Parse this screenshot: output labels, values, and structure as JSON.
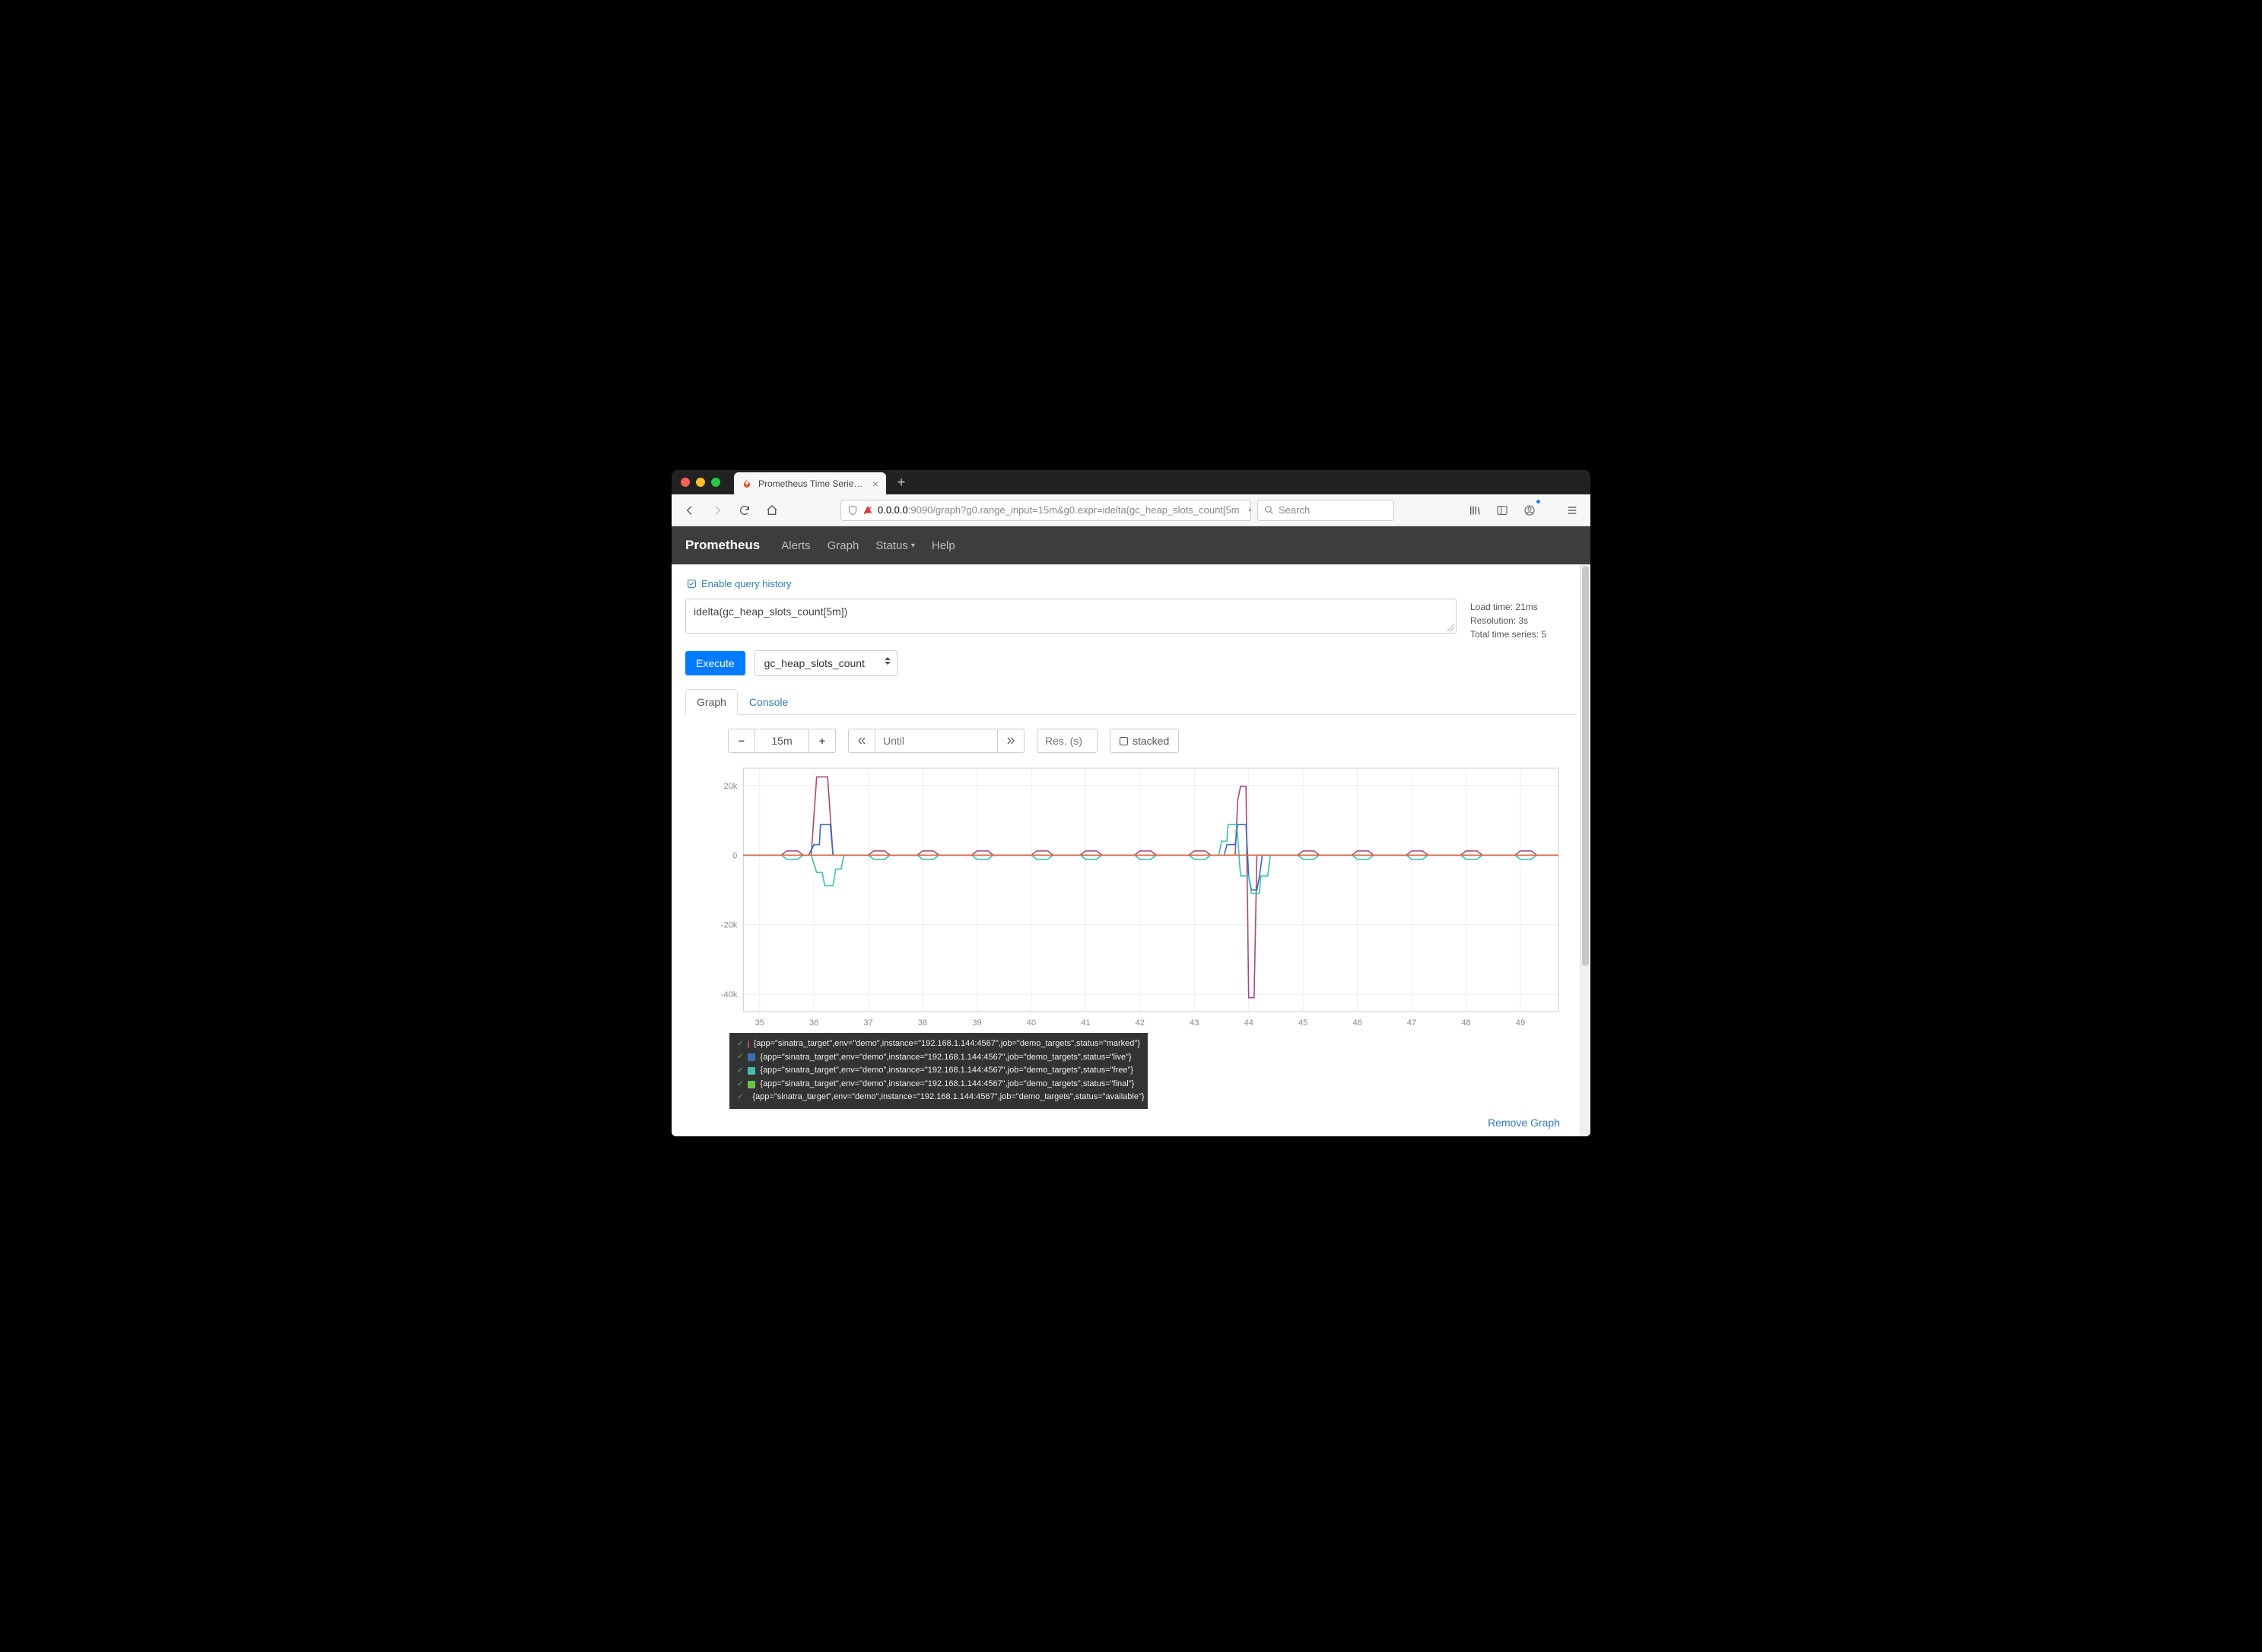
{
  "browser": {
    "tab_title": "Prometheus Time Series Collec",
    "url_host": "0.0.0.0",
    "url_rest": ":9090/graph?g0.range_input=15m&g0.expr=idelta(gc_heap_slots_count[5m",
    "search_placeholder": "Search"
  },
  "nav": {
    "brand": "Prometheus",
    "alerts": "Alerts",
    "graph": "Graph",
    "status": "Status",
    "help": "Help"
  },
  "query": {
    "history_label": "Enable query history",
    "expression": "idelta(gc_heap_slots_count[5m])",
    "execute": "Execute",
    "metric": "gc_heap_slots_count",
    "stats_load": "Load time: 21ms",
    "stats_res": "Resolution: 3s",
    "stats_series": "Total time series: 5"
  },
  "tabs": {
    "graph": "Graph",
    "console": "Console"
  },
  "controls": {
    "range": "15m",
    "until_placeholder": "Until",
    "res_placeholder": "Res. (s)",
    "stacked": "stacked"
  },
  "legend": {
    "colors": [
      "#a94a7c",
      "#3b6db3",
      "#3ec0b0",
      "#6cc24a",
      "#e06943"
    ],
    "items": [
      "{app=\"sinatra_target\",env=\"demo\",instance=\"192.168.1.144:4567\",job=\"demo_targets\",status=\"marked\"}",
      "{app=\"sinatra_target\",env=\"demo\",instance=\"192.168.1.144:4567\",job=\"demo_targets\",status=\"live\"}",
      "{app=\"sinatra_target\",env=\"demo\",instance=\"192.168.1.144:4567\",job=\"demo_targets\",status=\"free\"}",
      "{app=\"sinatra_target\",env=\"demo\",instance=\"192.168.1.144:4567\",job=\"demo_targets\",status=\"final\"}",
      "{app=\"sinatra_target\",env=\"demo\",instance=\"192.168.1.144:4567\",job=\"demo_targets\",status=\"available\"}"
    ]
  },
  "footer": {
    "remove": "Remove Graph"
  },
  "chart_data": {
    "type": "line",
    "xlabel": "",
    "ylabel": "",
    "x_ticks": [
      35,
      36,
      37,
      38,
      39,
      40,
      41,
      42,
      43,
      44,
      45,
      46,
      47,
      48,
      49
    ],
    "y_ticks": [
      -40000,
      -20000,
      0,
      20000
    ],
    "y_tick_labels": [
      "-40k",
      "-20k",
      "0",
      "20k"
    ],
    "ylim": [
      -45000,
      25000
    ],
    "xlim": [
      34.7,
      49.7
    ],
    "series": [
      {
        "name": "marked",
        "color": "#a94a7c",
        "values": [
          [
            34.7,
            0
          ],
          [
            35.4,
            0
          ],
          [
            35.5,
            1200
          ],
          [
            35.7,
            1200
          ],
          [
            35.8,
            0
          ],
          [
            35.95,
            0
          ],
          [
            36.05,
            22500
          ],
          [
            36.25,
            22500
          ],
          [
            36.35,
            0
          ],
          [
            37.0,
            0
          ],
          [
            37.1,
            1200
          ],
          [
            37.3,
            1200
          ],
          [
            37.4,
            0
          ],
          [
            37.9,
            0
          ],
          [
            38.0,
            1200
          ],
          [
            38.2,
            1200
          ],
          [
            38.3,
            0
          ],
          [
            38.9,
            0
          ],
          [
            39.0,
            1200
          ],
          [
            39.2,
            1200
          ],
          [
            39.3,
            0
          ],
          [
            40.0,
            0
          ],
          [
            40.1,
            1200
          ],
          [
            40.3,
            1200
          ],
          [
            40.4,
            0
          ],
          [
            40.9,
            0
          ],
          [
            41.0,
            1200
          ],
          [
            41.2,
            1200
          ],
          [
            41.3,
            0
          ],
          [
            41.9,
            0
          ],
          [
            42.0,
            1200
          ],
          [
            42.2,
            1200
          ],
          [
            42.3,
            0
          ],
          [
            42.9,
            0
          ],
          [
            43.0,
            1200
          ],
          [
            43.2,
            1200
          ],
          [
            43.3,
            0
          ],
          [
            43.75,
            0
          ],
          [
            43.8,
            16000
          ],
          [
            43.85,
            19800
          ],
          [
            43.95,
            19800
          ],
          [
            44.0,
            -41000
          ],
          [
            44.1,
            -41000
          ],
          [
            44.15,
            0
          ],
          [
            44.9,
            0
          ],
          [
            45.0,
            1200
          ],
          [
            45.2,
            1200
          ],
          [
            45.3,
            0
          ],
          [
            45.9,
            0
          ],
          [
            46.0,
            1200
          ],
          [
            46.2,
            1200
          ],
          [
            46.3,
            0
          ],
          [
            46.9,
            0
          ],
          [
            47.0,
            1200
          ],
          [
            47.2,
            1200
          ],
          [
            47.3,
            0
          ],
          [
            47.9,
            0
          ],
          [
            48.0,
            1200
          ],
          [
            48.2,
            1200
          ],
          [
            48.3,
            0
          ],
          [
            48.9,
            0
          ],
          [
            49.0,
            1200
          ],
          [
            49.2,
            1200
          ],
          [
            49.3,
            0
          ],
          [
            49.7,
            0
          ]
        ]
      },
      {
        "name": "live",
        "color": "#3b6db3",
        "values": [
          [
            34.7,
            0
          ],
          [
            35.9,
            0
          ],
          [
            36.0,
            3000
          ],
          [
            36.1,
            3000
          ],
          [
            36.12,
            8800
          ],
          [
            36.3,
            8800
          ],
          [
            36.35,
            0
          ],
          [
            43.55,
            0
          ],
          [
            43.6,
            3000
          ],
          [
            43.75,
            3000
          ],
          [
            43.8,
            8800
          ],
          [
            43.95,
            8800
          ],
          [
            44.0,
            -6000
          ],
          [
            44.05,
            -10000
          ],
          [
            44.15,
            -10000
          ],
          [
            44.2,
            -6000
          ],
          [
            44.25,
            0
          ],
          [
            49.7,
            0
          ]
        ]
      },
      {
        "name": "free",
        "color": "#3ec0b0",
        "values": [
          [
            34.7,
            0
          ],
          [
            35.4,
            0
          ],
          [
            35.5,
            -1200
          ],
          [
            35.7,
            -1200
          ],
          [
            35.8,
            0
          ],
          [
            35.95,
            0
          ],
          [
            36.05,
            -5000
          ],
          [
            36.15,
            -5000
          ],
          [
            36.2,
            -8800
          ],
          [
            36.35,
            -8800
          ],
          [
            36.4,
            -4000
          ],
          [
            36.5,
            -4000
          ],
          [
            36.55,
            0
          ],
          [
            37.0,
            0
          ],
          [
            37.1,
            -1200
          ],
          [
            37.3,
            -1200
          ],
          [
            37.4,
            0
          ],
          [
            37.9,
            0
          ],
          [
            38.0,
            -1200
          ],
          [
            38.2,
            -1200
          ],
          [
            38.3,
            0
          ],
          [
            38.9,
            0
          ],
          [
            39.0,
            -1200
          ],
          [
            39.2,
            -1200
          ],
          [
            39.3,
            0
          ],
          [
            40.0,
            0
          ],
          [
            40.1,
            -1200
          ],
          [
            40.3,
            -1200
          ],
          [
            40.4,
            0
          ],
          [
            40.9,
            0
          ],
          [
            41.0,
            -1200
          ],
          [
            41.2,
            -1200
          ],
          [
            41.3,
            0
          ],
          [
            41.9,
            0
          ],
          [
            42.0,
            -1200
          ],
          [
            42.2,
            -1200
          ],
          [
            42.3,
            0
          ],
          [
            42.9,
            0
          ],
          [
            43.0,
            -1200
          ],
          [
            43.2,
            -1200
          ],
          [
            43.3,
            0
          ],
          [
            43.45,
            0
          ],
          [
            43.5,
            4000
          ],
          [
            43.6,
            4000
          ],
          [
            43.62,
            8800
          ],
          [
            43.78,
            8800
          ],
          [
            43.85,
            -6000
          ],
          [
            44.0,
            -6000
          ],
          [
            44.05,
            -11000
          ],
          [
            44.2,
            -11000
          ],
          [
            44.22,
            -6000
          ],
          [
            44.35,
            -6000
          ],
          [
            44.4,
            0
          ],
          [
            44.9,
            0
          ],
          [
            45.0,
            -1200
          ],
          [
            45.2,
            -1200
          ],
          [
            45.3,
            0
          ],
          [
            45.9,
            0
          ],
          [
            46.0,
            -1200
          ],
          [
            46.2,
            -1200
          ],
          [
            46.3,
            0
          ],
          [
            46.9,
            0
          ],
          [
            47.0,
            -1200
          ],
          [
            47.2,
            -1200
          ],
          [
            47.3,
            0
          ],
          [
            47.9,
            0
          ],
          [
            48.0,
            -1200
          ],
          [
            48.2,
            -1200
          ],
          [
            48.3,
            0
          ],
          [
            48.9,
            0
          ],
          [
            49.0,
            -1200
          ],
          [
            49.2,
            -1200
          ],
          [
            49.3,
            0
          ],
          [
            49.7,
            0
          ]
        ]
      },
      {
        "name": "final",
        "color": "#6cc24a",
        "values": [
          [
            34.7,
            0
          ],
          [
            49.7,
            0
          ]
        ]
      },
      {
        "name": "available",
        "color": "#e06943",
        "values": [
          [
            34.7,
            0
          ],
          [
            49.7,
            0
          ]
        ]
      }
    ]
  }
}
